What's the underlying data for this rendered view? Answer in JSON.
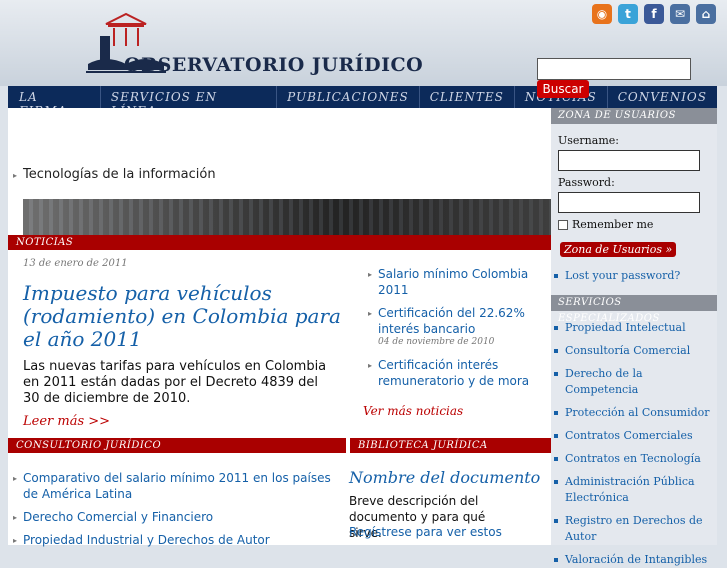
{
  "brand": {
    "title": "OBSERVATORIO JURÍDICO"
  },
  "social": [
    "rss-icon",
    "twitter-icon",
    "facebook-icon",
    "mail-icon",
    "home-icon"
  ],
  "search": {
    "button": "Buscar"
  },
  "nav": [
    "LA FIRMA",
    "SERVICIOS EN LÍNEA",
    "PUBLICACIONES",
    "CLIENTES",
    "NOTICIAS",
    "CONVENIOS"
  ],
  "tech": "Tecnologías de la información",
  "news": {
    "header": "NOTICIAS",
    "date": "13 de enero de 2011",
    "headline": "Impuesto para vehículos (rodamiento) en Colombia para el año 2011",
    "body": "Las nuevas tarifas para vehículos en Colombia en 2011 están dadas por el Decreto 4839  del 30 de diciembre de 2010.",
    "more": "Leer más >>",
    "side_items": [
      {
        "title": "Salario mínimo Colombia 2011",
        "date": ""
      },
      {
        "title": "Certificación del 22.62% interés bancario",
        "date": "04 de noviembre de 2010"
      },
      {
        "title": "Certificación interés remuneratorio y de mora",
        "date": ""
      }
    ],
    "see_more": "Ver más noticias"
  },
  "consultorio": {
    "header": "CONSULTORIO JURÍDICO",
    "items": [
      "Comparativo del salario mínimo 2011 en los países de América Latina",
      "Derecho Comercial y Financiero",
      "Propiedad Industrial y Derechos de Autor"
    ]
  },
  "biblioteca": {
    "header": "BIBLIOTECA JURÍDICA",
    "doc_title": "Nombre del documento",
    "desc": "Breve descripción del documento y para qué sirve.",
    "register": "Regístrese para ver estos"
  },
  "users": {
    "header": "ZONA DE USUARIOS",
    "username": "Username:",
    "password": "Password:",
    "remember": "Remember me",
    "button": "Zona de Usuarios »",
    "lost": "Lost your password?"
  },
  "services": {
    "header": "SERVICIOS ESPECIALIZADOS",
    "items": [
      "Propiedad Intelectual",
      "Consultoría Comercial",
      "Derecho de la Competencia",
      "Protección al Consumidor",
      "Contratos Comerciales",
      "Contratos en Tecnología",
      "Administración Pública Electrónica",
      "Registro en Derechos de Autor",
      "Valoración de Intangibles"
    ]
  }
}
